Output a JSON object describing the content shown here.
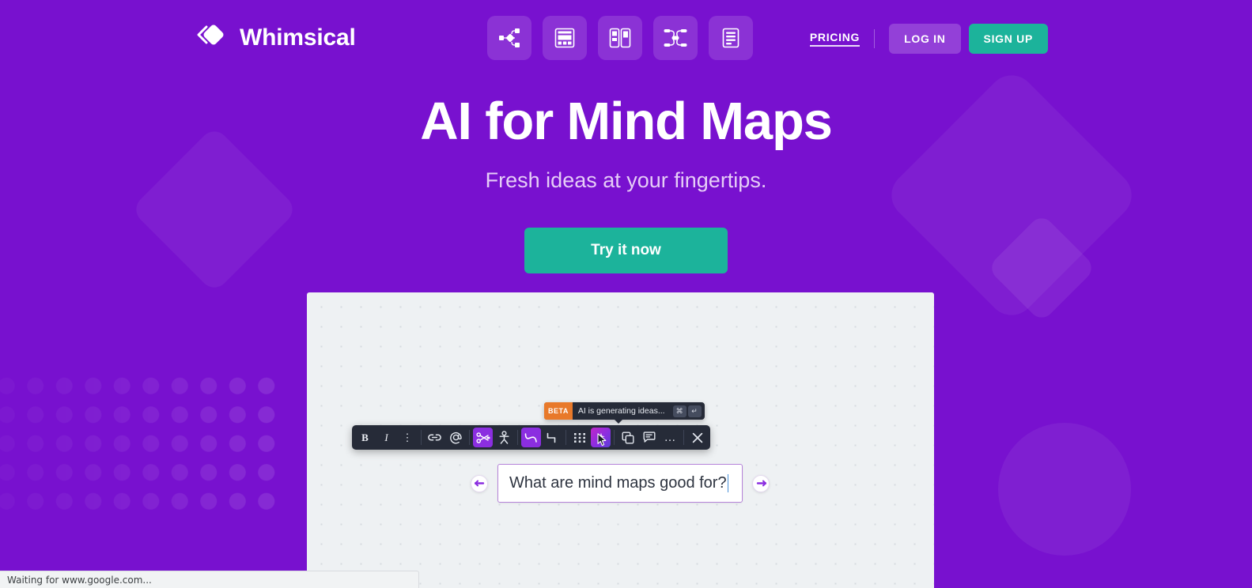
{
  "brand": {
    "name": "Whimsical",
    "logo_icon": "whimsical-diamond-logo"
  },
  "header": {
    "nav_icons": [
      {
        "name": "flowchart-icon",
        "label": "Flowcharts"
      },
      {
        "name": "wireframe-icon",
        "label": "Wireframes"
      },
      {
        "name": "board-icon",
        "label": "Sticky Notes"
      },
      {
        "name": "mindmap-icon",
        "label": "Mind Maps"
      },
      {
        "name": "docs-icon",
        "label": "Docs"
      }
    ],
    "pricing_label": "PRICING",
    "login_label": "LOG IN",
    "signup_label": "SIGN UP"
  },
  "hero": {
    "title": "AI for Mind Maps",
    "subtitle": "Fresh ideas at your fingertips.",
    "cta_label": "Try it now"
  },
  "ai_tooltip": {
    "badge": "BETA",
    "message": "AI is generating ideas...",
    "key_primary": "⌘",
    "key_secondary": "↵"
  },
  "toolbar": {
    "items": [
      {
        "name": "bold-button",
        "glyph": "B",
        "kind": "letter",
        "state": "default"
      },
      {
        "name": "italic-button",
        "glyph": "I",
        "kind": "letter-italic",
        "state": "default"
      },
      {
        "name": "more-text-options-button",
        "glyph": "⋮",
        "kind": "glyph",
        "state": "default"
      },
      {
        "name": "link-icon",
        "kind": "icon",
        "state": "default"
      },
      {
        "name": "mention-icon",
        "kind": "icon",
        "state": "default"
      },
      {
        "name": "connector-icon",
        "kind": "icon",
        "state": "active"
      },
      {
        "name": "person-icon",
        "kind": "icon",
        "state": "default"
      },
      {
        "name": "curved-line-icon",
        "kind": "icon",
        "state": "active"
      },
      {
        "name": "elbow-line-icon",
        "kind": "icon",
        "state": "default"
      },
      {
        "name": "grid-dots-icon",
        "kind": "icon",
        "state": "default"
      },
      {
        "name": "ai-generate-icon",
        "kind": "icon",
        "state": "gradient-hovered"
      },
      {
        "name": "duplicate-icon",
        "kind": "icon",
        "state": "default"
      },
      {
        "name": "comment-icon",
        "kind": "icon",
        "state": "default"
      },
      {
        "name": "more-options-button",
        "glyph": "…",
        "kind": "glyph",
        "state": "default"
      },
      {
        "name": "close-button",
        "kind": "icon",
        "state": "default"
      }
    ]
  },
  "node": {
    "text": "What are mind maps good for?",
    "left_handle": "add-sibling-left-handle",
    "right_handle": "add-child-right-handle"
  },
  "statusbar": {
    "text": "Waiting for www.google.com..."
  },
  "colors": {
    "brand_purple": "#7811cf",
    "accent_teal": "#1cb39b",
    "toolbar_dark": "#262b38",
    "beta_orange": "#e8792a",
    "active_purple": "#8b2ee0",
    "node_border": "#b583d9",
    "canvas_bg": "#eef1f3"
  }
}
